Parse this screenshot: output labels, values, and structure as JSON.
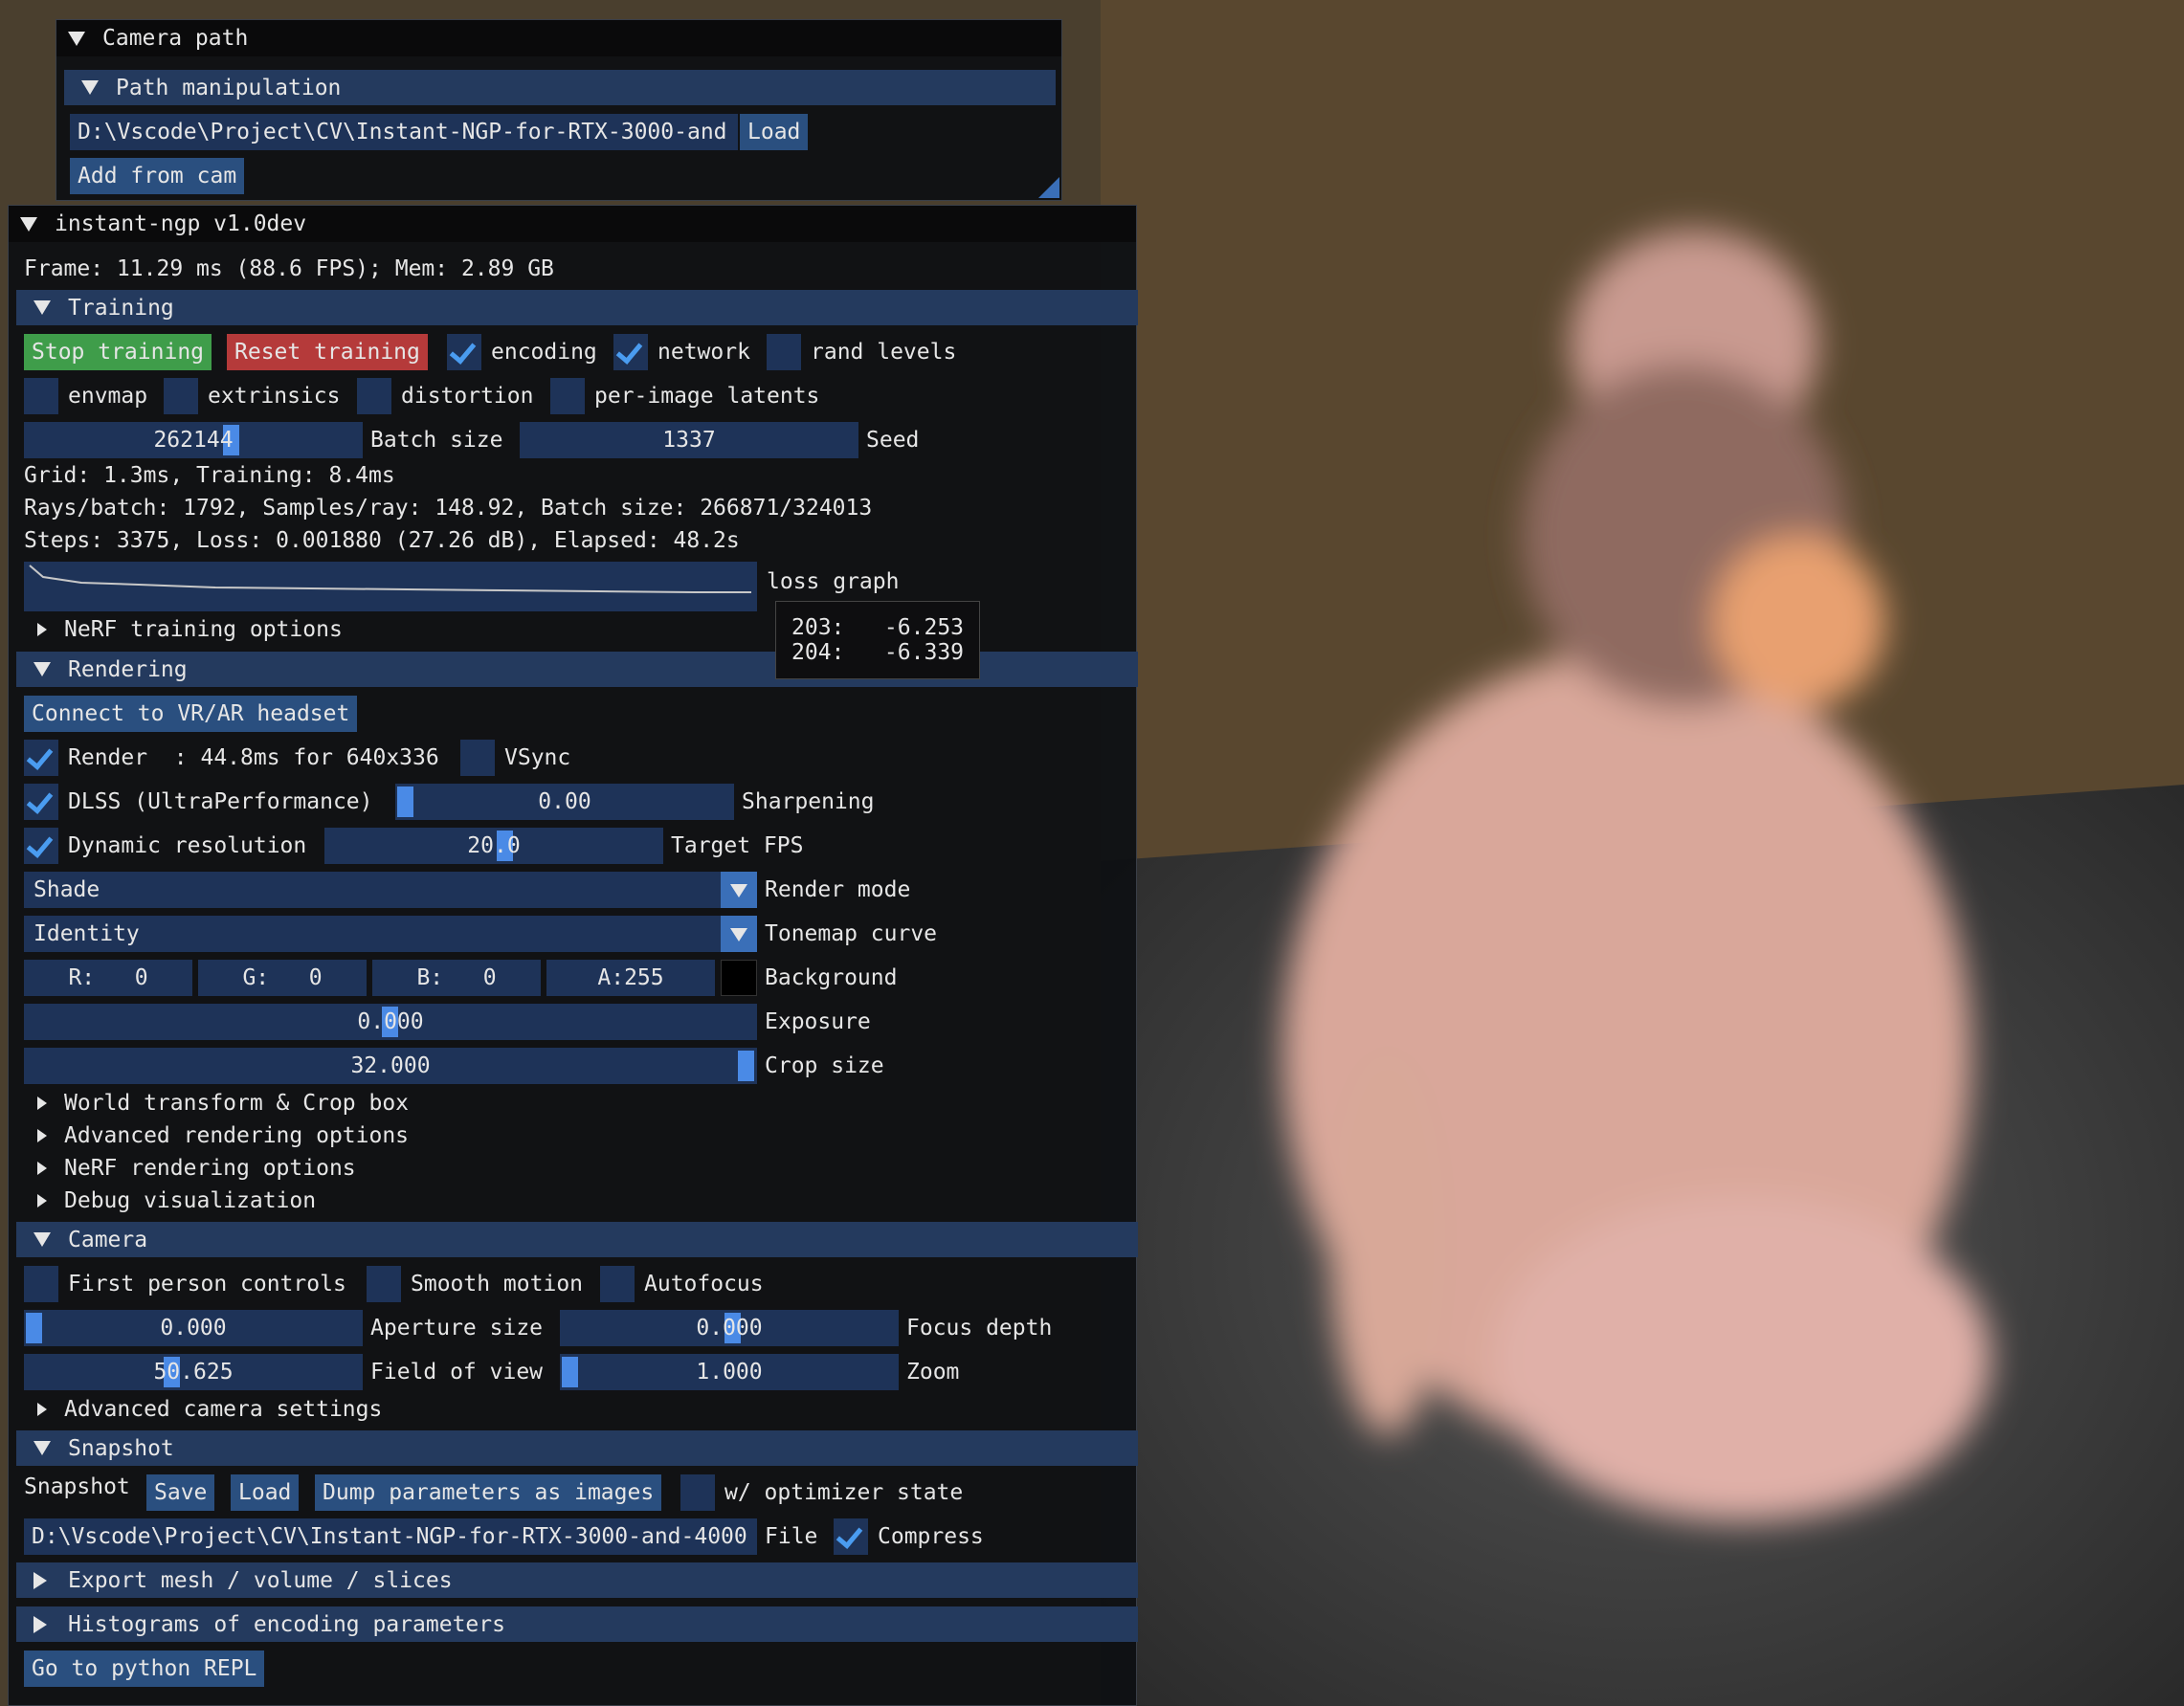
{
  "camera_path": {
    "title": "Camera path",
    "path_manipulation": "Path manipulation",
    "path_value": "D:\\Vscode\\Project\\CV\\Instant-NGP-for-RTX-3000-and",
    "load": "Load",
    "add_from_cam": "Add from cam"
  },
  "main": {
    "title": "instant-ngp v1.0dev",
    "frame_info": "Frame: 11.29 ms (88.6 FPS); Mem: 2.89 GB"
  },
  "training": {
    "header": "Training",
    "stop": "Stop training",
    "reset": "Reset training",
    "encoding": "encoding",
    "network": "network",
    "rand_levels": "rand levels",
    "envmap": "envmap",
    "extrinsics": "extrinsics",
    "distortion": "distortion",
    "per_image_latents": "per-image latents",
    "batch_value": "262144",
    "batch_label": "Batch size",
    "seed_value": "1337",
    "seed_label": "Seed",
    "grid_line": "Grid: 1.3ms, Training: 8.4ms",
    "rays_line": "Rays/batch: 1792, Samples/ray: 148.92, Batch size: 266871/324013",
    "steps_line": "Steps: 3375, Loss: 0.001880 (27.26 dB), Elapsed: 48.2s",
    "loss_graph": "loss graph",
    "tooltip_1": "203:   -6.253",
    "tooltip_2": "204:   -6.339",
    "nerf_training_options": "NeRF training options"
  },
  "rendering": {
    "header": "Rendering",
    "connect_vr": "Connect to VR/AR headset",
    "render": "Render  : 44.8ms for 640x336",
    "vsync": "VSync",
    "dlss": "DLSS (UltraPerformance)",
    "sharpening_value": "0.00",
    "sharpening_label": "Sharpening",
    "dynamic_res": "Dynamic resolution",
    "target_fps_value": "20.0",
    "target_fps_label": "Target FPS",
    "render_mode_value": "Shade",
    "render_mode_label": "Render mode",
    "tonemap_value": "Identity",
    "tonemap_label": "Tonemap curve",
    "r": "R:   0",
    "g": "G:   0",
    "b": "B:   0",
    "a": "A:255",
    "background_label": "Background",
    "exposure_value": "0.000",
    "exposure_label": "Exposure",
    "crop_value": "32.000",
    "crop_label": "Crop size",
    "world_transform": "World transform & Crop box",
    "advanced_rendering": "Advanced rendering options",
    "nerf_rendering": "NeRF rendering options",
    "debug_vis": "Debug visualization"
  },
  "camera": {
    "header": "Camera",
    "first_person": "First person controls",
    "smooth_motion": "Smooth motion",
    "autofocus": "Autofocus",
    "aperture_value": "0.000",
    "aperture_label": "Aperture size",
    "focus_value": "0.000",
    "focus_label": "Focus depth",
    "fov_value": "50.625",
    "fov_label": "Field of view",
    "zoom_value": "1.000",
    "zoom_label": "Zoom",
    "advanced_camera": "Advanced camera settings"
  },
  "snapshot": {
    "header": "Snapshot",
    "label": "Snapshot",
    "save": "Save",
    "load": "Load",
    "dump": "Dump parameters as images",
    "optimizer": "w/ optimizer state",
    "file_value": "D:\\Vscode\\Project\\CV\\Instant-NGP-for-RTX-3000-and-4000",
    "file_label": "File",
    "compress": "Compress"
  },
  "export_mesh": "Export mesh / volume / slices",
  "histograms": "Histograms of encoding parameters",
  "python_repl": "Go to python REPL",
  "colors": {
    "panel_bg": "#0f1114",
    "header": "#243a5e",
    "field": "#1e3358",
    "button": "#2a4f7f",
    "green": "#3f9d4a",
    "red": "#b53a3a",
    "check": "#4a9cf0"
  }
}
